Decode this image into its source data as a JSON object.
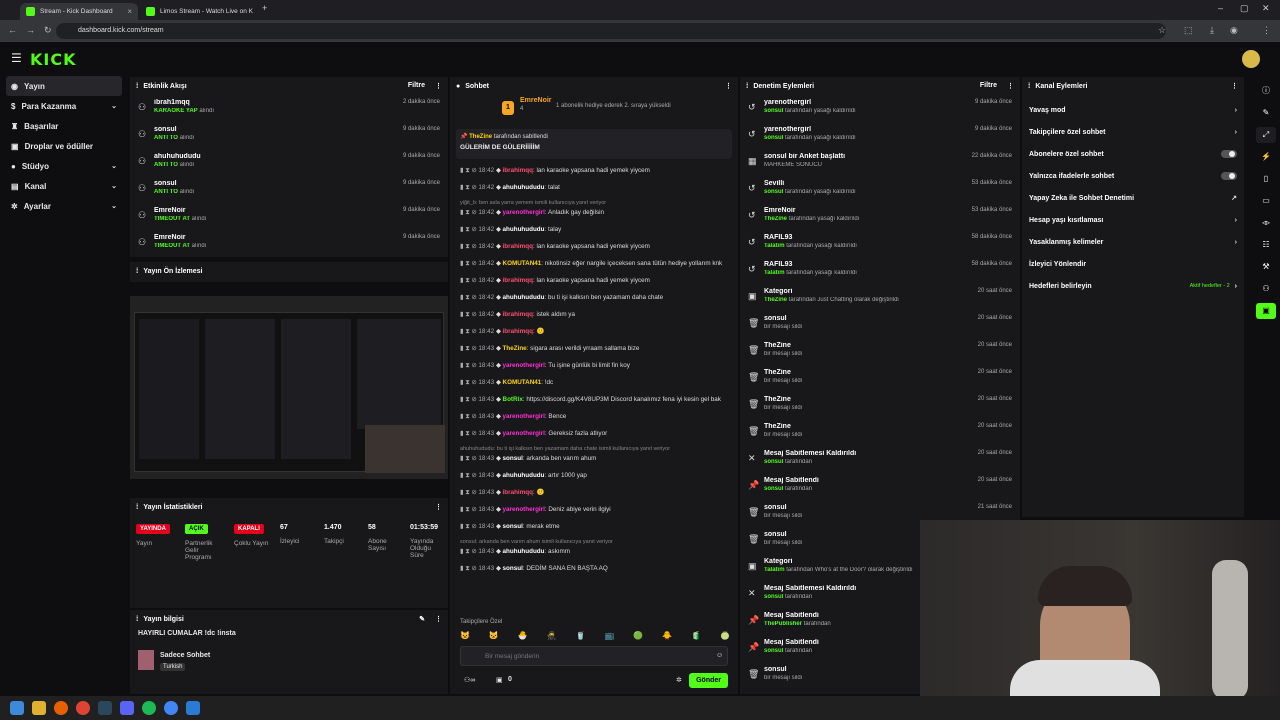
{
  "browser": {
    "tabs": [
      {
        "title": "Stream - Kick Dashboard"
      },
      {
        "title": "Limos Stream - Watch Live on K"
      }
    ],
    "url": "dashboard.kick.com/stream"
  },
  "nav": {
    "logo": "KICK"
  },
  "sidebar": {
    "items": [
      {
        "label": "Yayın",
        "chevron": ""
      },
      {
        "label": "Para Kazanma",
        "chevron": "⌄"
      },
      {
        "label": "Başarılar",
        "chevron": ""
      },
      {
        "label": "Droplar ve ödüller",
        "chevron": ""
      },
      {
        "label": "Stüdyo",
        "chevron": "⌄"
      },
      {
        "label": "Kanal",
        "chevron": "⌄"
      },
      {
        "label": "Ayarlar",
        "chevron": "⌄"
      }
    ]
  },
  "activity": {
    "title": "Etkinlik Akışı",
    "filter": "Filtre",
    "items": [
      {
        "user": "ibrah1mqq",
        "action": "KARAOKE YAP",
        "suffix": "alındı",
        "time": "2 dakika önce"
      },
      {
        "user": "sonsul",
        "action": "ANTİ TO",
        "suffix": "alındı",
        "time": "9 dakika önce"
      },
      {
        "user": "ahuhuhududu",
        "action": "ANTİ TO",
        "suffix": "alındı",
        "time": "9 dakika önce"
      },
      {
        "user": "sonsul",
        "action": "ANTİ TO",
        "suffix": "alındı",
        "time": "9 dakika önce"
      },
      {
        "user": "EmreNoir",
        "action": "TIMEOUT AT",
        "suffix": "alındı",
        "time": "9 dakika önce"
      },
      {
        "user": "EmreNoir",
        "action": "TIMEOUT AT",
        "suffix": "alındı",
        "time": "9 dakika önce"
      }
    ]
  },
  "preview": {
    "title": "Yayın Ön İzlemesi"
  },
  "stats": {
    "title": "Yayın İstatistikleri",
    "items": [
      {
        "value": "YAYINDA",
        "label": "Yayın",
        "color": "#e3001b"
      },
      {
        "value": "AÇIK",
        "label": "Partnerlik Gelir Programı",
        "color": "#53fc18"
      },
      {
        "value": "KAPALI",
        "label": "Çoklu Yayın",
        "color": "#e3001b"
      },
      {
        "value": "67",
        "label": "İzleyici"
      },
      {
        "value": "1.470",
        "label": "Takipçi"
      },
      {
        "value": "58",
        "label": "Abone Sayısı"
      },
      {
        "value": "01:53:59",
        "label": "Yayında Olduğu Süre"
      }
    ]
  },
  "info": {
    "title": "Yayın bilgisi",
    "stream_title": "HAYIRLI CUMALAR !dc !insta",
    "category": "Sadece Sohbet",
    "language": "Turkish"
  },
  "chat": {
    "title": "Sohbet",
    "top_user": "EmreNoir",
    "top_count": "4",
    "top_text": "1 abonelik hediye ederek 2. sıraya yükseldi",
    "pinned_by": "TheZine",
    "pinned_suffix": "tarafından sabitlendi",
    "pinned_text": "GÜLERİM DE GÜLERİİİİİM",
    "messages": [
      {
        "time": "18:42",
        "user": "ibrahimqq",
        "color": "#ff4d6d",
        "text": ": lan karaoke yapsana hadi yemek yiycem"
      },
      {
        "time": "18:42",
        "user": "ahuhuhududu",
        "color": "#ffffff",
        "text": ": talat"
      },
      {
        "reply": "yiğit_b: ben asla yarra yemem ismili kullanıcıya yanıt veriyor"
      },
      {
        "time": "18:42",
        "user": "yarenothergirl",
        "color": "#ff2fd5",
        "text": ": Anladık gay değilsin"
      },
      {
        "time": "18:42",
        "user": "ahuhuhududu",
        "color": "#ffffff",
        "text": ": talay"
      },
      {
        "time": "18:42",
        "user": "ibrahimqq",
        "color": "#ff4d6d",
        "text": ": lan karaoke yapsana hadi yemek yiycem"
      },
      {
        "time": "18:42",
        "user": "KOMUTAN41",
        "color": "#ffd400",
        "text": ": nikotinsiz eğer nargile içeceksen sana tütün hediye yollarım knk"
      },
      {
        "time": "18:42",
        "user": "ibrahimqq",
        "color": "#ff4d6d",
        "text": ": lan karaoke yapsana hadi yemek yiycem"
      },
      {
        "time": "18:42",
        "user": "ahuhuhududu",
        "color": "#ffffff",
        "text": ": bu ti işi kalksın ben yazamam daha chate"
      },
      {
        "time": "18:42",
        "user": "ibrahimqq",
        "color": "#ff4d6d",
        "text": ": istek aldım ya"
      },
      {
        "time": "18:42",
        "user": "ibrahimqq",
        "color": "#ff4d6d",
        "text": ": 🙂"
      },
      {
        "time": "18:43",
        "user": "TheZine",
        "color": "#ffd400",
        "text": ": sigara arası verildi yrraam sallama bize"
      },
      {
        "time": "18:43",
        "user": "yarenothergirl",
        "color": "#ff2fd5",
        "text": ": Tu işine günlük bi limit fin koy"
      },
      {
        "time": "18:43",
        "user": "KOMUTAN41",
        "color": "#ffd400",
        "text": ": !dc"
      },
      {
        "time": "18:43",
        "user": "BotRix",
        "color": "#53fc18",
        "text": ": https://discord.gg/K4V8UP3M Discord kanalımız fena iyi kesin gel bak"
      },
      {
        "time": "18:43",
        "user": "yarenothergirl",
        "color": "#ff2fd5",
        "text": ": Bence"
      },
      {
        "time": "18:43",
        "user": "yarenothergirl",
        "color": "#ff2fd5",
        "text": ": Gereksiz fazla atlıyor"
      },
      {
        "reply": "ahuhuhududu: bu ti işi kalksın ben yazamam daha chate isimli kullanıcıya yanıt veriyor"
      },
      {
        "time": "18:43",
        "user": "sonsul",
        "color": "#ffffff",
        "text": ": arkanda ben varım ahum"
      },
      {
        "time": "18:43",
        "user": "ahuhuhududu",
        "color": "#ffffff",
        "text": ": artır 1000 yap"
      },
      {
        "time": "18:43",
        "user": "ibrahimqq",
        "color": "#ff4d6d",
        "text": ": 🙂"
      },
      {
        "time": "18:43",
        "user": "yarenothergirl",
        "color": "#ff2fd5",
        "text": ": Deniz abiye verin ilgiyi"
      },
      {
        "time": "18:43",
        "user": "sonsul",
        "color": "#ffffff",
        "text": ": merak etme"
      },
      {
        "reply": "sonsul: arkanda ben varım ahum isimli kullanıcıya yanıt veriyor"
      },
      {
        "time": "18:43",
        "user": "ahuhuhududu",
        "color": "#ffffff",
        "text": ": askımm"
      },
      {
        "time": "18:43",
        "user": "sonsul",
        "color": "#ffffff",
        "text": ": DEDİM SANA EN BAŞTA AQ"
      }
    ],
    "followers_only": "Takipçilere Özel",
    "input_placeholder": "Bir mesaj gönderin",
    "count": "0",
    "send": "Gönder"
  },
  "moderation": {
    "title": "Denetim Eylemleri",
    "filter": "Filtre",
    "items": [
      {
        "icon": "undo-icon",
        "glyph": "↺",
        "title": "yarenothergirl",
        "actor": "sonsul",
        "desc": "tarafından yasağı kaldırıldı",
        "time": "9 dakika önce"
      },
      {
        "icon": "undo-icon",
        "glyph": "↺",
        "title": "yarenothergirl",
        "actor": "sonsul",
        "desc": "tarafından yasağı kaldırıldı",
        "time": "9 dakika önce"
      },
      {
        "icon": "poll-icon",
        "glyph": "▦",
        "title": "sonsul bir Anket başlattı",
        "actor": "",
        "desc": "MAHKEME SONUCU",
        "time": "22 dakika önce"
      },
      {
        "icon": "undo-icon",
        "glyph": "↺",
        "title": "Sevilli",
        "actor": "sonsul",
        "desc": "tarafından yasağı kaldırıldı",
        "time": "53 dakika önce"
      },
      {
        "icon": "undo-icon",
        "glyph": "↺",
        "title": "EmreNoir",
        "actor": "TheZine",
        "desc": "tarafından yasağı kaldırıldı",
        "time": "53 dakika önce"
      },
      {
        "icon": "undo-icon",
        "glyph": "↺",
        "title": "RAFIL93",
        "actor": "Talatım",
        "desc": "tarafından yasağı kaldırıldı",
        "time": "58 dakika önce"
      },
      {
        "icon": "undo-icon",
        "glyph": "↺",
        "title": "RAFIL93",
        "actor": "Talatım",
        "desc": "tarafından yasağı kaldırıldı",
        "time": "58 dakika önce"
      },
      {
        "icon": "category-icon",
        "glyph": "▣",
        "title": "Kategori",
        "actor": "TheZine",
        "desc": "tarafından Just Chatting olarak değiştirildi",
        "time": "20 saat önce"
      },
      {
        "icon": "trash-icon",
        "glyph": "🗑",
        "title": "sonsul",
        "actor": "",
        "desc": "bir mesajı sildi",
        "time": "20 saat önce"
      },
      {
        "icon": "trash-icon",
        "glyph": "🗑",
        "title": "TheZine",
        "actor": "",
        "desc": "bir mesajı sildi",
        "time": "20 saat önce"
      },
      {
        "icon": "trash-icon",
        "glyph": "🗑",
        "title": "TheZine",
        "actor": "",
        "desc": "bir mesajı sildi",
        "time": "20 saat önce"
      },
      {
        "icon": "trash-icon",
        "glyph": "🗑",
        "title": "TheZine",
        "actor": "",
        "desc": "bir mesajı sildi",
        "time": "20 saat önce"
      },
      {
        "icon": "trash-icon",
        "glyph": "🗑",
        "title": "TheZine",
        "actor": "",
        "desc": "bir mesajı sildi",
        "time": "20 saat önce"
      },
      {
        "icon": "unpin-icon",
        "glyph": "✕",
        "title": "Mesaj Sabitlemesi Kaldırıldı",
        "actor": "sonsul",
        "desc": "tarafından",
        "time": "20 saat önce"
      },
      {
        "icon": "pin-icon",
        "glyph": "📌",
        "title": "Mesaj Sabitlendi",
        "actor": "sonsul",
        "desc": "tarafından",
        "time": "20 saat önce"
      },
      {
        "icon": "trash-icon",
        "glyph": "🗑",
        "title": "sonsul",
        "actor": "",
        "desc": "bir mesajı sildi",
        "time": "21 saat önce"
      },
      {
        "icon": "trash-icon",
        "glyph": "🗑",
        "title": "sonsul",
        "actor": "",
        "desc": "bir mesajı sildi",
        "time": ""
      },
      {
        "icon": "category-icon",
        "glyph": "▣",
        "title": "Kategori",
        "actor": "Talatım",
        "desc": "tarafından Who's at the Door? olarak değiştirildi",
        "time": ""
      },
      {
        "icon": "unpin-icon",
        "glyph": "✕",
        "title": "Mesaj Sabitlemesi Kaldırıldı",
        "actor": "sonsul",
        "desc": "tarafından",
        "time": ""
      },
      {
        "icon": "pin-icon",
        "glyph": "📌",
        "title": "Mesaj Sabitlendi",
        "actor": "ThePublisher",
        "desc": "tarafından",
        "time": ""
      },
      {
        "icon": "pin-icon",
        "glyph": "📌",
        "title": "Mesaj Sabitlendi",
        "actor": "sonsul",
        "desc": "tarafından",
        "time": ""
      },
      {
        "icon": "trash-icon",
        "glyph": "🗑",
        "title": "sonsul",
        "actor": "",
        "desc": "bir mesajı sildi",
        "time": ""
      }
    ]
  },
  "channel": {
    "title": "Kanal Eylemleri",
    "items": [
      {
        "label": "Yavaş mod",
        "right": "›"
      },
      {
        "label": "Takipçilere özel sohbet",
        "right": "›"
      },
      {
        "label": "Abonelere özel sohbet",
        "right": "toggle"
      },
      {
        "label": "Yalnızca ifadelerle sohbet",
        "right": "toggle"
      },
      {
        "label": "Yapay Zeka ile Sohbet Denetimi",
        "right": "↗"
      },
      {
        "label": "Hesap yaşı kısıtlaması",
        "right": "›"
      },
      {
        "label": "Yasaklanmış kelimeler",
        "right": "›"
      },
      {
        "label": "İzleyici Yönlendir",
        "right": ""
      },
      {
        "label": "Hedefleri belirleyin",
        "right": "›",
        "note": "Aktif hedefler - 2"
      }
    ]
  },
  "colors": {
    "accent": "#53fc18",
    "live": "#e3001b"
  }
}
